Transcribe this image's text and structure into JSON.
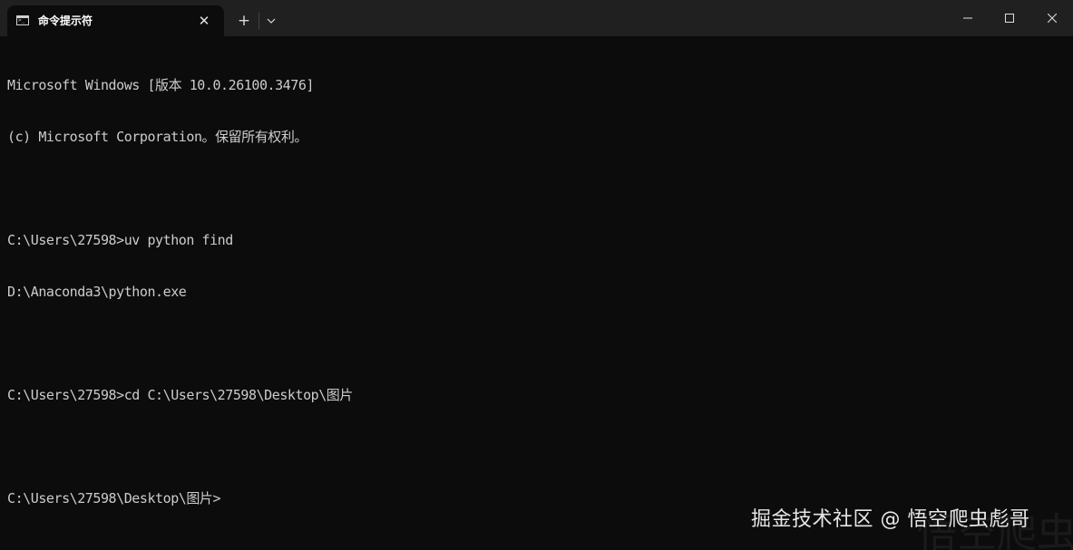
{
  "tab": {
    "title": "命令提示符",
    "icon": "terminal-icon",
    "close_glyph": "✕"
  },
  "titlebar": {
    "new_tab_glyph": "+",
    "dropdown_icon": "chevron-down-icon"
  },
  "window_controls": {
    "minimize_icon": "minimize-icon",
    "maximize_icon": "maximize-icon",
    "close_icon": "close-icon"
  },
  "terminal": {
    "lines": [
      "Microsoft Windows [版本 10.0.26100.3476]",
      "(c) Microsoft Corporation。保留所有权利。",
      "",
      "C:\\Users\\27598>uv python find",
      "D:\\Anaconda3\\python.exe",
      "",
      "C:\\Users\\27598>cd C:\\Users\\27598\\Desktop\\图片",
      "",
      "C:\\Users\\27598\\Desktop\\图片>"
    ]
  },
  "watermark": {
    "text": "掘金技术社区 @ 悟空爬虫彪哥",
    "faint_text": "悟空爬虫"
  },
  "colors": {
    "background": "#0c0c0c",
    "titlebar": "#202020",
    "text": "#cccccc"
  }
}
